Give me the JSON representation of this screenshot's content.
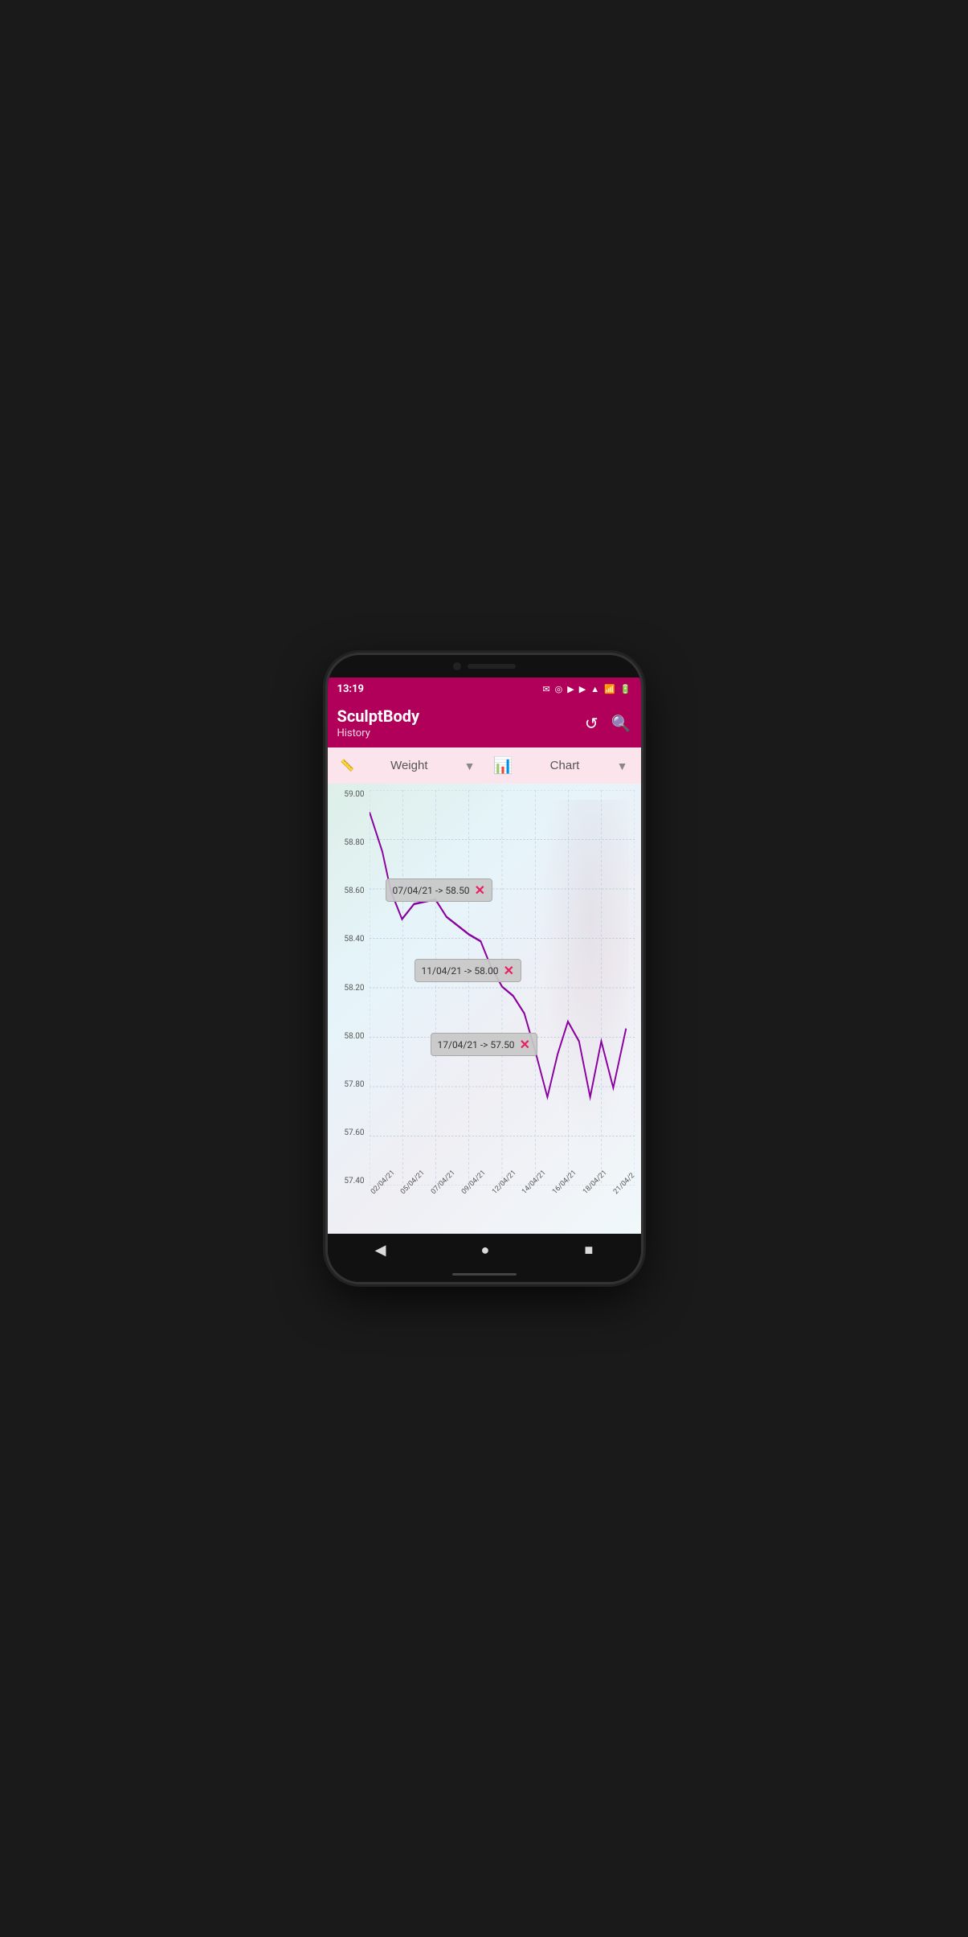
{
  "phone": {
    "status_bar": {
      "time": "13:19",
      "icons": [
        "✉",
        "◎",
        "▶",
        "▶"
      ]
    },
    "app_bar": {
      "title": "SculptBody",
      "subtitle": "History",
      "back_label": "↺",
      "search_label": "🔍"
    },
    "toolbar": {
      "weight_icon": "📏",
      "weight_label": "Weight",
      "chart_icon": "📊",
      "chart_label": "Chart",
      "dropdown_arrow": "▼"
    },
    "chart": {
      "y_labels": [
        "59.00",
        "58.80",
        "58.60",
        "58.40",
        "58.20",
        "58.00",
        "57.80",
        "57.60",
        "57.40"
      ],
      "x_labels": [
        "02/04/21",
        "05/04/21",
        "07/04/21",
        "09/04/21",
        "12/04/21",
        "14/04/21",
        "16/04/21",
        "18/04/21",
        "21/04/2"
      ],
      "tooltips": [
        {
          "text": "07/04/21 -> 58.50",
          "id": "tooltip-1"
        },
        {
          "text": "11/04/21 -> 58.00",
          "id": "tooltip-2"
        },
        {
          "text": "17/04/21 -> 57.50",
          "id": "tooltip-3"
        }
      ],
      "close_label": "✕"
    },
    "nav_bar": {
      "back": "◀",
      "home": "●",
      "recent": "■"
    }
  }
}
